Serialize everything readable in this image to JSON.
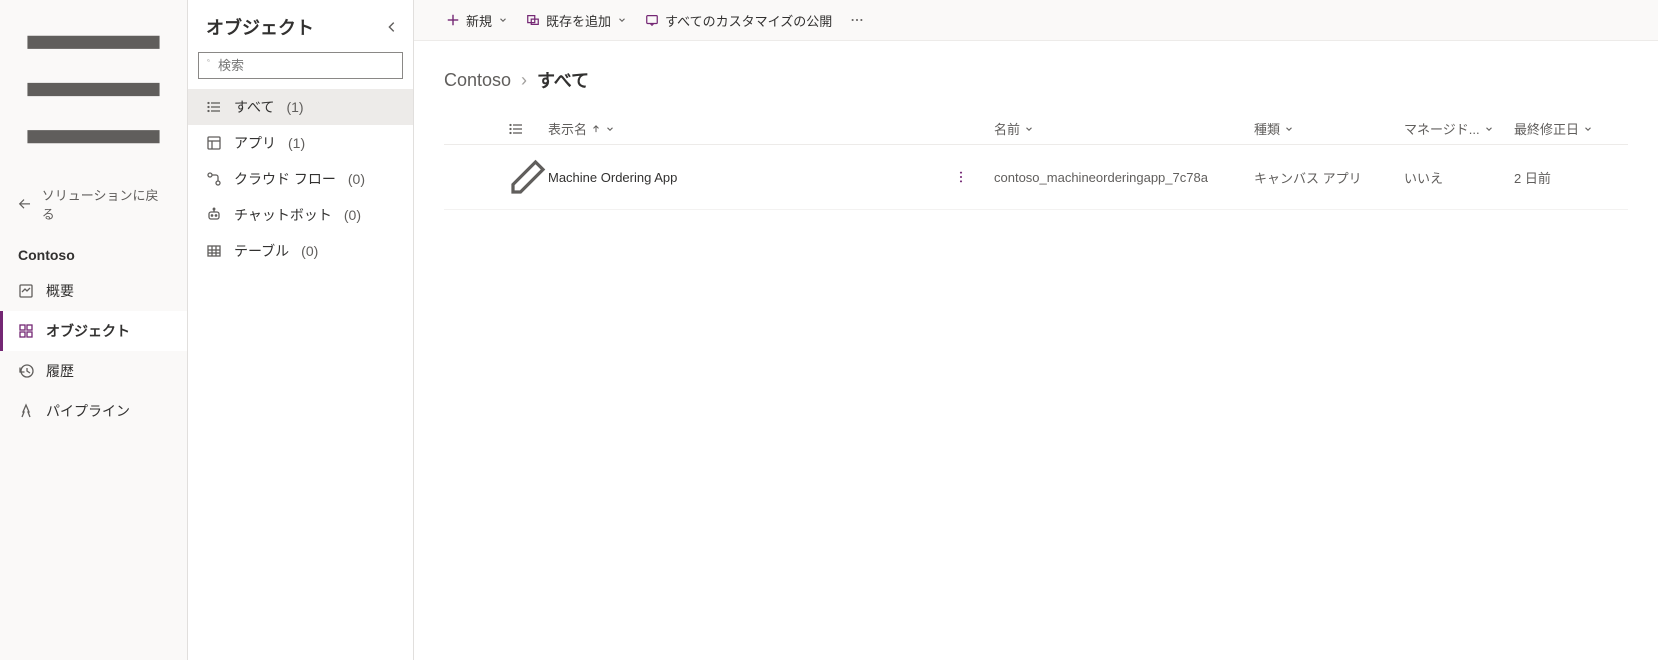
{
  "sidebar": {
    "back_label": "ソリューションに戻る",
    "solution_name": "Contoso",
    "items": [
      {
        "label": "概要"
      },
      {
        "label": "オブジェクト"
      },
      {
        "label": "履歴"
      },
      {
        "label": "パイプライン"
      }
    ],
    "selected_index": 1
  },
  "objects_panel": {
    "title": "オブジェクト",
    "search_placeholder": "検索",
    "tree": [
      {
        "label": "すべて",
        "count": "(1)",
        "selected": true
      },
      {
        "label": "アプリ",
        "count": "(1)"
      },
      {
        "label": "クラウド フロー",
        "count": "(0)"
      },
      {
        "label": "チャットボット",
        "count": "(0)"
      },
      {
        "label": "テーブル",
        "count": "(0)"
      }
    ]
  },
  "commandbar": {
    "new": "新規",
    "add_existing": "既存を追加",
    "publish_all": "すべてのカスタマイズの公開"
  },
  "breadcrumb": {
    "root": "Contoso",
    "current": "すべて"
  },
  "table": {
    "columns": {
      "display_name": "表示名",
      "name": "名前",
      "type": "種類",
      "managed": "マネージド...",
      "modified": "最終修正日"
    },
    "rows": [
      {
        "display_name": "Machine Ordering App",
        "name": "contoso_machineorderingapp_7c78a",
        "type": "キャンバス アプリ",
        "managed": "いいえ",
        "modified": "2 日前"
      }
    ]
  }
}
